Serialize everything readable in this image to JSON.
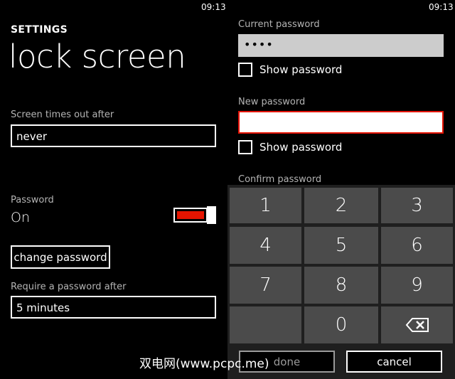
{
  "left": {
    "clock": "09:13",
    "settings_label": "SETTINGS",
    "page_title": "lock screen",
    "timeout_label": "Screen times out after",
    "timeout_value": "never",
    "password_label": "Password",
    "password_state": "On",
    "change_password_button": "change password",
    "require_label": "Require a password after",
    "require_value": "5 minutes"
  },
  "right": {
    "clock": "09:13",
    "current_password_label": "Current password",
    "current_password_value": "••••",
    "show_password_label_1": "Show password",
    "new_password_label": "New password",
    "new_password_value": "",
    "show_password_label_2": "Show password",
    "confirm_password_label": "Confirm password",
    "keypad": [
      "1",
      "2",
      "3",
      "4",
      "5",
      "6",
      "7",
      "8",
      "9",
      "0"
    ],
    "backspace_icon": "backspace-icon",
    "done_button": "done",
    "cancel_button": "cancel"
  },
  "watermark": "双电网(www.pcpc.me)",
  "colors": {
    "accent": "#e51400",
    "background": "#000000",
    "key": "#4b4b4b",
    "field_bg": "#cccccc"
  }
}
